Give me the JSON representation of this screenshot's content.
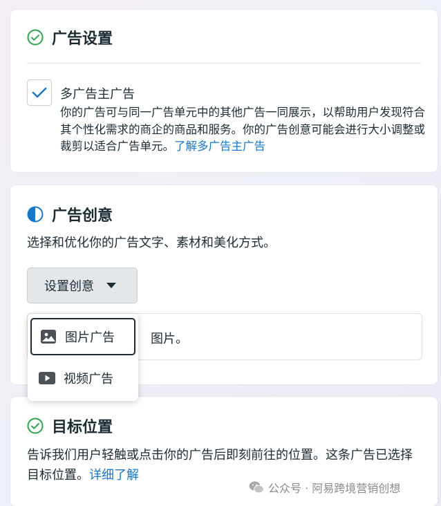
{
  "ad_settings": {
    "title": "广告设置",
    "multi_advertiser": {
      "checked": true,
      "label": "多广告主广告",
      "description": "你的广告可与同一广告单元中的其他广告一同展示，以帮助用户发现符合其个性化需求的商企的商品和服务。你的广告创意可能会进行大小调整或裁剪以适合广告单元。",
      "link": "了解多广告主广告"
    }
  },
  "ad_creative": {
    "title": "广告创意",
    "description": "选择和优化你的广告文字、素材和美化方式。",
    "setup_button": "设置创意",
    "hidden_text": "图片。",
    "dropdown": {
      "items": [
        {
          "label": "图片广告",
          "icon": "image-icon",
          "selected": true
        },
        {
          "label": "视频广告",
          "icon": "video-icon",
          "selected": false
        }
      ]
    }
  },
  "destination": {
    "title": "目标位置",
    "description": "告诉我们用户轻触或点击你的广告后即刻前往的位置。这条广告已选择目标位置。",
    "link": "详细了解"
  },
  "watermark": {
    "text": "公众号 · 阿易跨境营销创想"
  },
  "colors": {
    "accent": "#1877c9",
    "success": "#31a24c",
    "text": "#1c2b33"
  }
}
